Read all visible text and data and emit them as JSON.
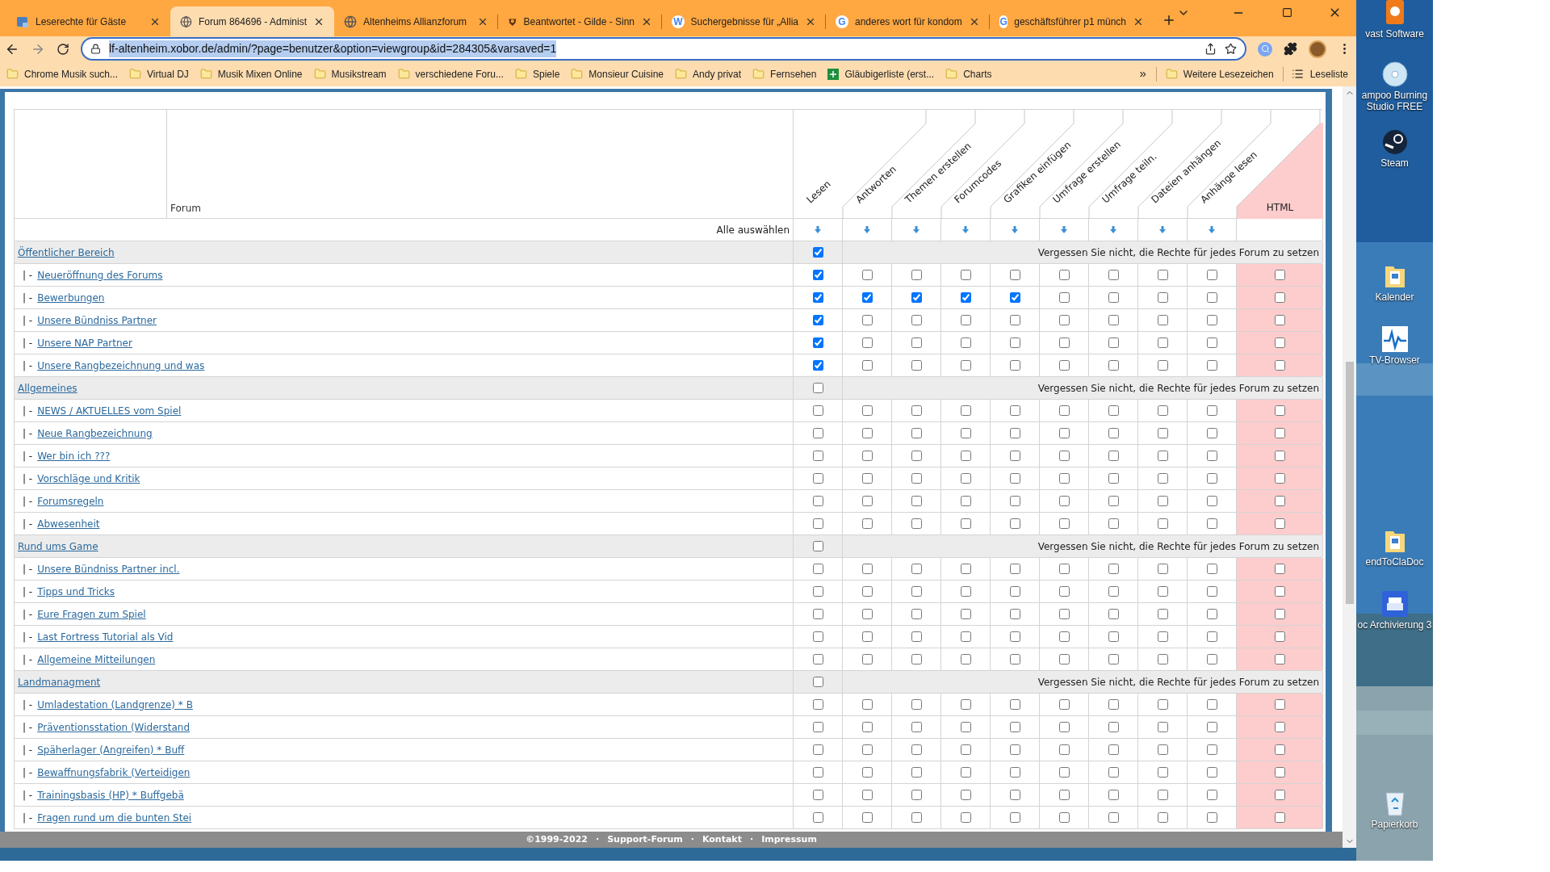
{
  "browser": {
    "tabs": [
      {
        "title": "Leserechte für Gäste",
        "selected": false,
        "favicon": {
          "kind": "app"
        }
      },
      {
        "title": "Forum 864696 - Administ",
        "selected": true,
        "favicon": {
          "kind": "globe"
        }
      },
      {
        "title": "Altenheims Allianzforum",
        "selected": false,
        "favicon": {
          "kind": "globe"
        }
      },
      {
        "title": "Beantwortet - Gilde - Sinn",
        "selected": false,
        "favicon": {
          "kind": "crest"
        }
      },
      {
        "title": "Suchergebnisse für „Allia",
        "selected": false,
        "favicon": {
          "kind": "letter",
          "glyph": "W"
        }
      },
      {
        "title": "anderes wort für kondom",
        "selected": false,
        "favicon": {
          "kind": "letter",
          "glyph": "G"
        }
      },
      {
        "title": "geschäftsführer p1 münch",
        "selected": false,
        "favicon": {
          "kind": "letter",
          "glyph": "G"
        }
      }
    ],
    "url": "lf-altenheim.xobor.de/admin/?page=benutzer&option=viewgroup&id=284305&varsaved=1",
    "bookmarks": [
      {
        "label": "Chrome Musik such...",
        "kind": "folder"
      },
      {
        "label": "Virtual DJ",
        "kind": "folder"
      },
      {
        "label": "Musik Mixen Online",
        "kind": "folder"
      },
      {
        "label": "Musikstream",
        "kind": "folder"
      },
      {
        "label": "verschiedene Foru...",
        "kind": "folder"
      },
      {
        "label": "Spiele",
        "kind": "folder"
      },
      {
        "label": "Monsieur Cuisine",
        "kind": "folder"
      },
      {
        "label": "Andy privat",
        "kind": "folder"
      },
      {
        "label": "Fernsehen",
        "kind": "folder"
      },
      {
        "label": "Gläubigerliste (erst...",
        "kind": "sheet"
      },
      {
        "label": "Charts",
        "kind": "folder"
      }
    ],
    "more": "»",
    "other_bookmarks": "Weitere Lesezeichen",
    "reading_list": "Leseliste"
  },
  "table": {
    "forum_heading": "Forum",
    "columns": [
      "Lesen",
      "Antworten",
      "Themen erstellen",
      "Forumcodes",
      "Grafiken einfügen",
      "Umfrage erstellen",
      "Umfrage teiln.",
      "Dateien anhängen",
      "Anhänge lesen",
      "HTML"
    ],
    "select_all": "Alle auswählen",
    "categories": [
      {
        "name": "Öffentlicher Bereich",
        "checked": true,
        "note": "Vergessen Sie nicht, die Rechte für jedes Forum zu setzen",
        "forums": [
          {
            "prefix": "| -",
            "name": "Neueröffnung des Forums",
            "perms": [
              true,
              false,
              false,
              false,
              false,
              false,
              false,
              false,
              false,
              false
            ]
          },
          {
            "prefix": "| -",
            "name": "Bewerbungen",
            "perms": [
              true,
              true,
              true,
              true,
              true,
              false,
              false,
              false,
              false,
              false
            ]
          },
          {
            "prefix": "| -",
            "name": "Unsere Bündniss Partner",
            "perms": [
              true,
              false,
              false,
              false,
              false,
              false,
              false,
              false,
              false,
              false
            ]
          },
          {
            "prefix": "| -",
            "name": "Unsere NAP Partner",
            "perms": [
              true,
              false,
              false,
              false,
              false,
              false,
              false,
              false,
              false,
              false
            ]
          },
          {
            "prefix": "| -",
            "name": "Unsere Rangbezeichnung und was",
            "perms": [
              true,
              false,
              false,
              false,
              false,
              false,
              false,
              false,
              false,
              false
            ]
          }
        ]
      },
      {
        "name": "Allgemeines",
        "checked": false,
        "note": "Vergessen Sie nicht, die Rechte für jedes Forum zu setzen",
        "forums": [
          {
            "prefix": "| -",
            "name": "NEWS / AKTUELLES vom Spiel",
            "perms": [
              false,
              false,
              false,
              false,
              false,
              false,
              false,
              false,
              false,
              false
            ]
          },
          {
            "prefix": "| -",
            "name": "Neue Rangbezeichnung",
            "perms": [
              false,
              false,
              false,
              false,
              false,
              false,
              false,
              false,
              false,
              false
            ]
          },
          {
            "prefix": "| -",
            "name": "Wer bin ich ???",
            "perms": [
              false,
              false,
              false,
              false,
              false,
              false,
              false,
              false,
              false,
              false
            ]
          },
          {
            "prefix": "| -",
            "name": "Vorschläge und Kritik",
            "perms": [
              false,
              false,
              false,
              false,
              false,
              false,
              false,
              false,
              false,
              false
            ]
          },
          {
            "prefix": "| -",
            "name": "Forumsregeln",
            "perms": [
              false,
              false,
              false,
              false,
              false,
              false,
              false,
              false,
              false,
              false
            ]
          },
          {
            "prefix": "| -",
            "name": "Abwesenheit",
            "perms": [
              false,
              false,
              false,
              false,
              false,
              false,
              false,
              false,
              false,
              false
            ]
          }
        ]
      },
      {
        "name": "Rund ums Game",
        "checked": false,
        "note": "Vergessen Sie nicht, die Rechte für jedes Forum zu setzen",
        "forums": [
          {
            "prefix": "| -",
            "name": "Unsere Bündniss Partner incl.",
            "perms": [
              false,
              false,
              false,
              false,
              false,
              false,
              false,
              false,
              false,
              false
            ]
          },
          {
            "prefix": "| -",
            "name": "Tipps und Tricks",
            "perms": [
              false,
              false,
              false,
              false,
              false,
              false,
              false,
              false,
              false,
              false
            ]
          },
          {
            "prefix": "| -",
            "name": "Eure Fragen zum Spiel",
            "perms": [
              false,
              false,
              false,
              false,
              false,
              false,
              false,
              false,
              false,
              false
            ]
          },
          {
            "prefix": "| -",
            "name": "Last Fortress Tutorial als Vid",
            "perms": [
              false,
              false,
              false,
              false,
              false,
              false,
              false,
              false,
              false,
              false
            ]
          },
          {
            "prefix": "| -",
            "name": "Allgemeine Mitteilungen",
            "perms": [
              false,
              false,
              false,
              false,
              false,
              false,
              false,
              false,
              false,
              false
            ]
          }
        ]
      },
      {
        "name": "Landmanagment",
        "checked": false,
        "note": "Vergessen Sie nicht, die Rechte für jedes Forum zu setzen",
        "forums": [
          {
            "prefix": "| -",
            "name": "Umladestation (Landgrenze) * B",
            "perms": [
              false,
              false,
              false,
              false,
              false,
              false,
              false,
              false,
              false,
              false
            ]
          },
          {
            "prefix": "| -",
            "name": "Präventionsstation (Widerstand",
            "perms": [
              false,
              false,
              false,
              false,
              false,
              false,
              false,
              false,
              false,
              false
            ]
          },
          {
            "prefix": "| -",
            "name": "Späherlager (Angreifen) * Buff",
            "perms": [
              false,
              false,
              false,
              false,
              false,
              false,
              false,
              false,
              false,
              false
            ]
          },
          {
            "prefix": "| -",
            "name": "Bewaffnungsfabrik (Verteidigen",
            "perms": [
              false,
              false,
              false,
              false,
              false,
              false,
              false,
              false,
              false,
              false
            ]
          },
          {
            "prefix": "| -",
            "name": "Trainingsbasis (HP) * Buffgebä",
            "perms": [
              false,
              false,
              false,
              false,
              false,
              false,
              false,
              false,
              false,
              false
            ]
          },
          {
            "prefix": "| -",
            "name": "Fragen rund um die bunten Stei",
            "perms": [
              false,
              false,
              false,
              false,
              false,
              false,
              false,
              false,
              false,
              false
            ]
          }
        ]
      }
    ]
  },
  "footer": {
    "copyright": "©1999-2022",
    "links": [
      "Support-Forum",
      "Kontakt",
      "Impressum"
    ],
    "separator": "·"
  },
  "desktop": {
    "icons": [
      {
        "label": "vast Software",
        "kind": "app"
      },
      {
        "label": "ampoo Burning Studio FREE",
        "kind": "disc"
      },
      {
        "label": "Steam",
        "kind": "steam"
      },
      {
        "label": "Kalender",
        "kind": "folder"
      },
      {
        "label": "TV-Browser",
        "kind": "pulse"
      },
      {
        "label": "endToClaDoc",
        "kind": "folder"
      },
      {
        "label": "oc Archivierung 3",
        "kind": "printer"
      },
      {
        "label": "Papierkorb",
        "kind": "bin"
      }
    ]
  }
}
